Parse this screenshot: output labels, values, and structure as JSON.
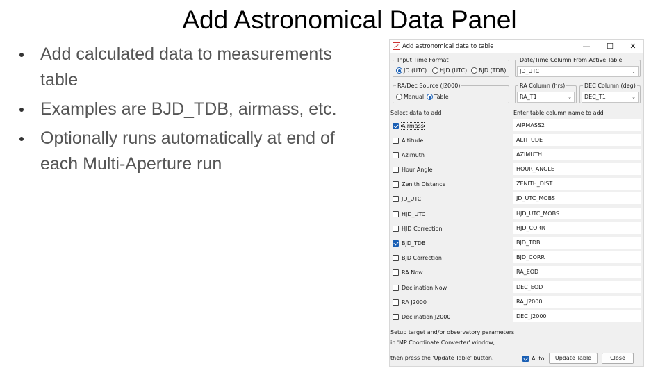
{
  "slide": {
    "title": "Add Astronomical Data Panel",
    "bullets": [
      "Add calculated data to measurements table",
      "Examples are BJD_TDB, airmass, etc.",
      "Optionally runs automatically at end of each Multi-Aperture run"
    ]
  },
  "dialog": {
    "title": "Add astronomical data to table",
    "controls": {
      "minimize": "—",
      "maximize": "☐",
      "close": "✕"
    },
    "input_time_format": {
      "legend": "Input Time Format",
      "options": [
        "JD (UTC)",
        "HJD (UTC)",
        "BJD (TDB)"
      ],
      "selected": "JD (UTC)"
    },
    "datetime_column": {
      "legend": "Date/Time Column From Active Table",
      "value": "JD_UTC"
    },
    "radec_source": {
      "legend": "RA/Dec Source (J2000)",
      "options": [
        "Manual",
        "Table"
      ],
      "selected": "Table"
    },
    "ra_column": {
      "legend": "RA Column (hrs)",
      "value": "RA_T1"
    },
    "dec_column": {
      "legend": "DEC Column (deg)",
      "value": "DEC_T1"
    },
    "select_header": "Select data to add",
    "name_header": "Enter table column name to add",
    "rows": [
      {
        "label": "Airmass",
        "checked": true,
        "column": "AIRMASS2"
      },
      {
        "label": "Altitude",
        "checked": false,
        "column": "ALTITUDE"
      },
      {
        "label": "Azimuth",
        "checked": false,
        "column": "AZIMUTH"
      },
      {
        "label": "Hour Angle",
        "checked": false,
        "column": "HOUR_ANGLE"
      },
      {
        "label": "Zenith Distance",
        "checked": false,
        "column": "ZENITH_DIST"
      },
      {
        "label": "JD_UTC",
        "checked": false,
        "column": "JD_UTC_MOBS"
      },
      {
        "label": "HJD_UTC",
        "checked": false,
        "column": "HJD_UTC_MOBS"
      },
      {
        "label": "HJD Correction",
        "checked": false,
        "column": "HJD_CORR"
      },
      {
        "label": "BJD_TDB",
        "checked": true,
        "column": "BJD_TDB"
      },
      {
        "label": "BJD Correction",
        "checked": false,
        "column": "BJD_CORR"
      },
      {
        "label": "RA Now",
        "checked": false,
        "column": "RA_EOD"
      },
      {
        "label": "Declination Now",
        "checked": false,
        "column": "DEC_EOD"
      },
      {
        "label": "RA J2000",
        "checked": false,
        "column": "RA_J2000"
      },
      {
        "label": "Declination J2000",
        "checked": false,
        "column": "DEC_J2000"
      }
    ],
    "notes": [
      "Setup target and/or observatory parameters",
      "in 'MP Coordinate Converter' window,",
      "then press the 'Update Table' button."
    ],
    "auto": {
      "label": "Auto",
      "checked": true
    },
    "update_button": "Update Table",
    "close_button": "Close",
    "accent": "#1a5fb4"
  }
}
